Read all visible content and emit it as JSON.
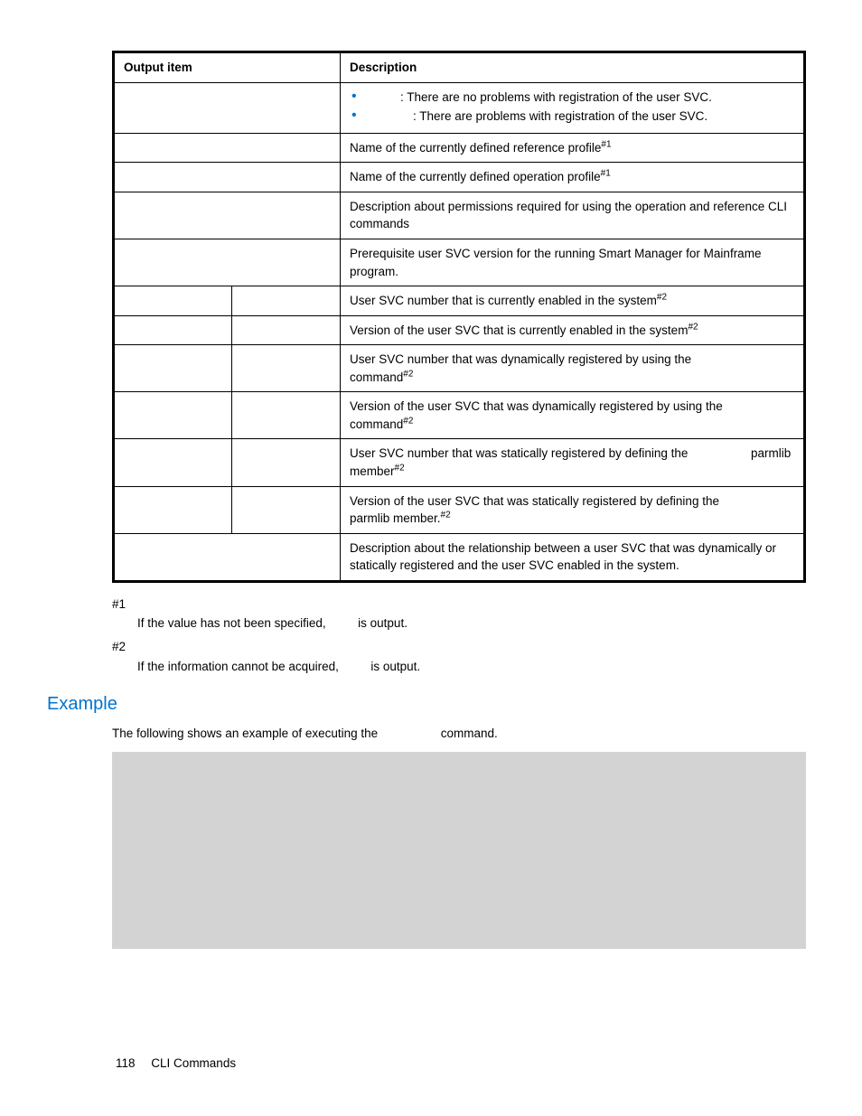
{
  "table": {
    "headers": {
      "item": "Output item",
      "desc": "Description"
    },
    "rows": [
      {
        "item": "",
        "sub": "",
        "desc_type": "bullets",
        "bullets": [
          {
            "pre": "",
            "text": ": There are no problems with registration of the user SVC."
          },
          {
            "pre": "",
            "text": ": There are problems with registration of the user SVC."
          }
        ]
      },
      {
        "item": "",
        "sub": "",
        "desc": "Name of the currently defined reference profile",
        "sup": "#1"
      },
      {
        "item": "",
        "sub": "",
        "desc": "Name of the currently defined operation profile",
        "sup": "#1"
      },
      {
        "item": "",
        "sub": "",
        "desc": "Description about permissions required for using the operation and reference CLI commands"
      },
      {
        "item": "",
        "sub": "",
        "desc": "Prerequisite user SVC version for the running Smart Manager for Mainframe program."
      },
      {
        "item": "",
        "sub_split": true,
        "sub": "",
        "desc": "User SVC number that is currently enabled in the system",
        "sup": "#2"
      },
      {
        "item": "",
        "sub_split": true,
        "sub": "",
        "desc": "Version of the user SVC that is currently enabled in the system",
        "sup": "#2"
      },
      {
        "item": "",
        "sub_split": true,
        "sub": "",
        "desc_parts": [
          "User SVC number that was dynamically registered by using the ",
          "",
          " command"
        ],
        "sup": "#2"
      },
      {
        "item": "",
        "sub_split": true,
        "sub": "",
        "desc_parts": [
          "Version of the user SVC that was dynamically registered by using the ",
          "",
          " command"
        ],
        "sup": "#2"
      },
      {
        "item": "",
        "sub_split": true,
        "sub": "",
        "desc_parts": [
          "User SVC number that was statically registered by defining the ",
          "",
          " parmlib member"
        ],
        "sup": "#2"
      },
      {
        "item": "",
        "sub_split": true,
        "sub": "",
        "desc_parts": [
          "Version of the user SVC that was statically registered by defining the ",
          "",
          " parmlib member."
        ],
        "sup": "#2"
      },
      {
        "item": "",
        "sub": "",
        "desc": "Description about the relationship between a user SVC that was dynamically or statically registered and the user SVC enabled in the system."
      }
    ]
  },
  "notes": {
    "n1_tag": "#1",
    "n1_a": "If the value has not been specified, ",
    "n1_b": " is output.",
    "n2_tag": "#2",
    "n2_a": "If the information cannot be acquired, ",
    "n2_b": " is output."
  },
  "example": {
    "heading": "Example",
    "intro_a": "The following shows an example of executing the ",
    "intro_b": " command."
  },
  "footer": {
    "page": "118",
    "section": "CLI Commands"
  }
}
